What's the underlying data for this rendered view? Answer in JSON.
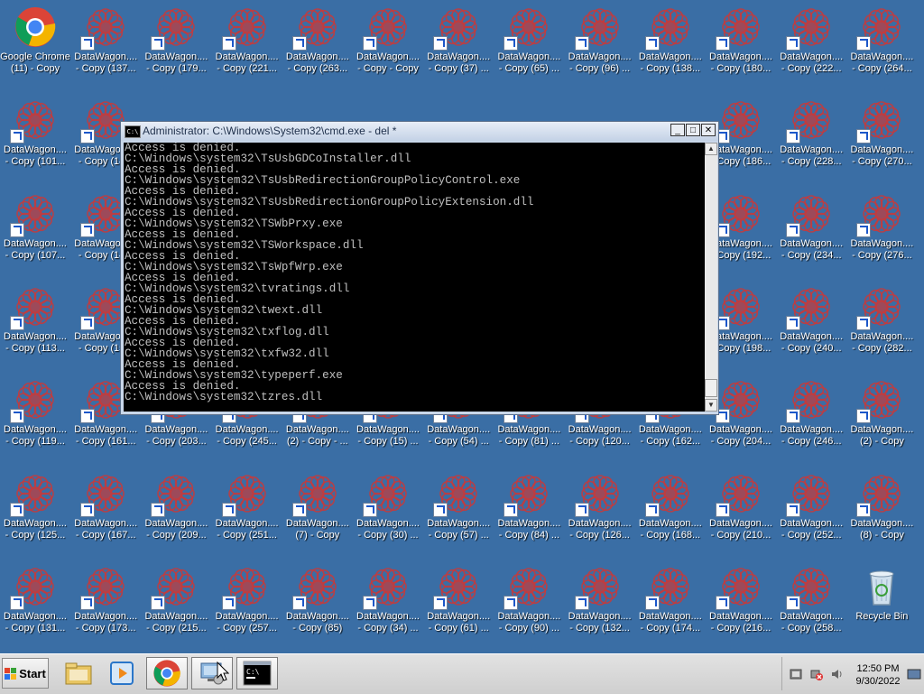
{
  "desktop": {
    "icons": [
      {
        "label": "Google Chrome\n(11) - Copy",
        "type": "chrome",
        "col": 0,
        "row": 0
      },
      {
        "label": "DataWagon....\n- Copy (137...",
        "type": "dw",
        "col": 1,
        "row": 0
      },
      {
        "label": "DataWagon....\n- Copy (179...",
        "type": "dw",
        "col": 2,
        "row": 0
      },
      {
        "label": "DataWagon....\n- Copy (221...",
        "type": "dw",
        "col": 3,
        "row": 0
      },
      {
        "label": "DataWagon....\n- Copy (263...",
        "type": "dw",
        "col": 4,
        "row": 0
      },
      {
        "label": "DataWagon....\n- Copy - Copy",
        "type": "dw",
        "col": 5,
        "row": 0
      },
      {
        "label": "DataWagon....\n- Copy (37) ...",
        "type": "dw",
        "col": 6,
        "row": 0
      },
      {
        "label": "DataWagon....\n- Copy (65) ...",
        "type": "dw",
        "col": 7,
        "row": 0
      },
      {
        "label": "DataWagon....\n- Copy (96) ...",
        "type": "dw",
        "col": 8,
        "row": 0
      },
      {
        "label": "DataWagon....\n- Copy (138...",
        "type": "dw",
        "col": 9,
        "row": 0
      },
      {
        "label": "DataWagon....\n- Copy (180...",
        "type": "dw",
        "col": 10,
        "row": 0
      },
      {
        "label": "DataWagon....\n- Copy (222...",
        "type": "dw",
        "col": 11,
        "row": 0
      },
      {
        "label": "DataWagon....\n- Copy (264...",
        "type": "dw",
        "col": 12,
        "row": 0
      },
      {
        "label": "DataWagon....\n- Copy (101...",
        "type": "dw",
        "col": 0,
        "row": 1
      },
      {
        "label": "DataWagon....\n- Copy (14...",
        "type": "dw",
        "col": 1,
        "row": 1
      },
      {
        "label": "DataWagon....\n- Copy (186...",
        "type": "dw",
        "col": 10,
        "row": 1
      },
      {
        "label": "DataWagon....\n- Copy (228...",
        "type": "dw",
        "col": 11,
        "row": 1
      },
      {
        "label": "DataWagon....\n- Copy (270...",
        "type": "dw",
        "col": 12,
        "row": 1
      },
      {
        "label": "DataWagon....\n- Copy (107...",
        "type": "dw",
        "col": 0,
        "row": 2
      },
      {
        "label": "DataWagon....\n- Copy (14...",
        "type": "dw",
        "col": 1,
        "row": 2
      },
      {
        "label": "DataWagon....\n- Copy (192...",
        "type": "dw",
        "col": 10,
        "row": 2
      },
      {
        "label": "DataWagon....\n- Copy (234...",
        "type": "dw",
        "col": 11,
        "row": 2
      },
      {
        "label": "DataWagon....\n- Copy (276...",
        "type": "dw",
        "col": 12,
        "row": 2
      },
      {
        "label": "DataWagon....\n- Copy (113...",
        "type": "dw",
        "col": 0,
        "row": 3
      },
      {
        "label": "DataWagon....\n- Copy (15...",
        "type": "dw",
        "col": 1,
        "row": 3
      },
      {
        "label": "DataWagon....\n- Copy (198...",
        "type": "dw",
        "col": 10,
        "row": 3
      },
      {
        "label": "DataWagon....\n- Copy (240...",
        "type": "dw",
        "col": 11,
        "row": 3
      },
      {
        "label": "DataWagon....\n- Copy (282...",
        "type": "dw",
        "col": 12,
        "row": 3
      },
      {
        "label": "DataWagon....\n- Copy (119...",
        "type": "dw",
        "col": 0,
        "row": 4
      },
      {
        "label": "DataWagon....\n- Copy (161...",
        "type": "dw",
        "col": 1,
        "row": 4
      },
      {
        "label": "DataWagon....\n- Copy (203...",
        "type": "dw",
        "col": 2,
        "row": 4
      },
      {
        "label": "DataWagon....\n- Copy (245...",
        "type": "dw",
        "col": 3,
        "row": 4
      },
      {
        "label": "DataWagon....\n(2) - Copy - ...",
        "type": "dw",
        "col": 4,
        "row": 4
      },
      {
        "label": "DataWagon....\n- Copy (15) ...",
        "type": "dw",
        "col": 5,
        "row": 4
      },
      {
        "label": "DataWagon....\n- Copy (54) ...",
        "type": "dw",
        "col": 6,
        "row": 4
      },
      {
        "label": "DataWagon....\n- Copy (81) ...",
        "type": "dw",
        "col": 7,
        "row": 4
      },
      {
        "label": "DataWagon....\n- Copy (120...",
        "type": "dw",
        "col": 8,
        "row": 4
      },
      {
        "label": "DataWagon....\n- Copy (162...",
        "type": "dw",
        "col": 9,
        "row": 4
      },
      {
        "label": "DataWagon....\n- Copy (204...",
        "type": "dw",
        "col": 10,
        "row": 4
      },
      {
        "label": "DataWagon....\n- Copy (246...",
        "type": "dw",
        "col": 11,
        "row": 4
      },
      {
        "label": "DataWagon....\n(2) - Copy",
        "type": "dw",
        "col": 12,
        "row": 4
      },
      {
        "label": "DataWagon....\n- Copy (125...",
        "type": "dw",
        "col": 0,
        "row": 5
      },
      {
        "label": "DataWagon....\n- Copy (167...",
        "type": "dw",
        "col": 1,
        "row": 5
      },
      {
        "label": "DataWagon....\n- Copy (209...",
        "type": "dw",
        "col": 2,
        "row": 5
      },
      {
        "label": "DataWagon....\n- Copy (251...",
        "type": "dw",
        "col": 3,
        "row": 5
      },
      {
        "label": "DataWagon....\n(7) - Copy",
        "type": "dw",
        "col": 4,
        "row": 5
      },
      {
        "label": "DataWagon....\n- Copy (30) ...",
        "type": "dw",
        "col": 5,
        "row": 5
      },
      {
        "label": "DataWagon....\n- Copy (57) ...",
        "type": "dw",
        "col": 6,
        "row": 5
      },
      {
        "label": "DataWagon....\n- Copy (84) ...",
        "type": "dw",
        "col": 7,
        "row": 5
      },
      {
        "label": "DataWagon....\n- Copy (126...",
        "type": "dw",
        "col": 8,
        "row": 5
      },
      {
        "label": "DataWagon....\n- Copy (168...",
        "type": "dw",
        "col": 9,
        "row": 5
      },
      {
        "label": "DataWagon....\n- Copy (210...",
        "type": "dw",
        "col": 10,
        "row": 5
      },
      {
        "label": "DataWagon....\n- Copy (252...",
        "type": "dw",
        "col": 11,
        "row": 5
      },
      {
        "label": "DataWagon....\n(8) - Copy",
        "type": "dw",
        "col": 12,
        "row": 5
      },
      {
        "label": "DataWagon....\n- Copy (131...",
        "type": "dw",
        "col": 0,
        "row": 6
      },
      {
        "label": "DataWagon....\n- Copy (173...",
        "type": "dw",
        "col": 1,
        "row": 6
      },
      {
        "label": "DataWagon....\n- Copy (215...",
        "type": "dw",
        "col": 2,
        "row": 6
      },
      {
        "label": "DataWagon....\n- Copy (257...",
        "type": "dw",
        "col": 3,
        "row": 6
      },
      {
        "label": "DataWagon....\n- Copy (85)",
        "type": "dw",
        "col": 4,
        "row": 6
      },
      {
        "label": "DataWagon....\n- Copy (34) ...",
        "type": "dw",
        "col": 5,
        "row": 6
      },
      {
        "label": "DataWagon....\n- Copy (61) ...",
        "type": "dw",
        "col": 6,
        "row": 6
      },
      {
        "label": "DataWagon....\n- Copy (90) ...",
        "type": "dw",
        "col": 7,
        "row": 6
      },
      {
        "label": "DataWagon....\n- Copy (132...",
        "type": "dw",
        "col": 8,
        "row": 6
      },
      {
        "label": "DataWagon....\n- Copy (174...",
        "type": "dw",
        "col": 9,
        "row": 6
      },
      {
        "label": "DataWagon....\n- Copy (216...",
        "type": "dw",
        "col": 10,
        "row": 6
      },
      {
        "label": "DataWagon....\n- Copy (258...",
        "type": "dw",
        "col": 11,
        "row": 6
      },
      {
        "label": "Recycle Bin",
        "type": "recycle",
        "col": 12,
        "row": 6
      }
    ]
  },
  "cmd_window": {
    "title": "Administrator: C:\\Windows\\System32\\cmd.exe - del  *",
    "icon_text": "C:\\",
    "minimize_glyph": "_",
    "maximize_glyph": "□",
    "close_glyph": "✕",
    "lines": [
      "Access is denied.",
      "C:\\Windows\\system32\\TsUsbGDCoInstaller.dll",
      "Access is denied.",
      "C:\\Windows\\system32\\TsUsbRedirectionGroupPolicyControl.exe",
      "Access is denied.",
      "C:\\Windows\\system32\\TsUsbRedirectionGroupPolicyExtension.dll",
      "Access is denied.",
      "C:\\Windows\\system32\\TSWbPrxy.exe",
      "Access is denied.",
      "C:\\Windows\\system32\\TSWorkspace.dll",
      "Access is denied.",
      "C:\\Windows\\system32\\TsWpfWrp.exe",
      "Access is denied.",
      "C:\\Windows\\system32\\tvratings.dll",
      "Access is denied.",
      "C:\\Windows\\system32\\twext.dll",
      "Access is denied.",
      "C:\\Windows\\system32\\txflog.dll",
      "Access is denied.",
      "C:\\Windows\\system32\\txfw32.dll",
      "Access is denied.",
      "C:\\Windows\\system32\\typeperf.exe",
      "Access is denied.",
      "C:\\Windows\\system32\\tzres.dll"
    ],
    "scroll_up_glyph": "▲",
    "scroll_down_glyph": "▼"
  },
  "taskbar": {
    "start_label": "Start",
    "buttons": [
      {
        "name": "explorer-taskbar-button",
        "icon": "folder-icon"
      },
      {
        "name": "media-player-taskbar-button",
        "icon": "media-player-icon"
      },
      {
        "name": "chrome-taskbar-button",
        "icon": "chrome-icon"
      },
      {
        "name": "server-manager-taskbar-button",
        "icon": "server-manager-icon"
      },
      {
        "name": "cmd-taskbar-button",
        "icon": "cmd-icon"
      }
    ],
    "clock_time": "12:50 PM",
    "clock_date": "9/30/2022"
  },
  "colors": {
    "desktop_bg": "#3a6ea5",
    "console_bg": "#000000",
    "console_fg": "#c0c0c0",
    "dw_logo": "#c83a3a"
  }
}
